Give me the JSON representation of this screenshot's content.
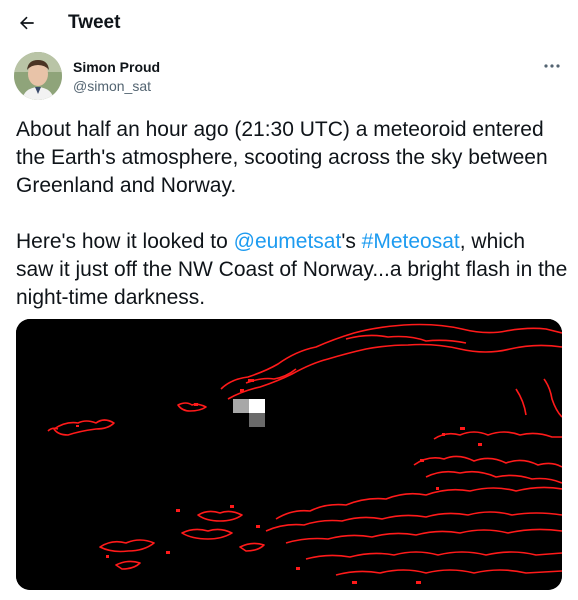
{
  "header": {
    "back_icon": "arrow-left-icon",
    "title": "Tweet"
  },
  "author": {
    "name": "Simon Proud",
    "handle": "@simon_sat",
    "avatar_icon": "user-avatar",
    "more_icon": "ellipsis-icon"
  },
  "tweet": {
    "para1": "About half an hour ago (21:30 UTC) a meteoroid entered the Earth's atmosphere, scooting across the sky between Greenland and Norway.",
    "para2_prefix": "Here's how it looked to ",
    "mention": "@eumetsat",
    "para2_mid": "'s ",
    "hashtag": "#Meteosat",
    "para2_suffix": ", which saw it just off the NW Coast of Norway...a bright flash in the night-time darkness."
  },
  "media": {
    "description_icon": "satellite-image",
    "coastline_color": "#ff1a1a",
    "background_color": "#000000"
  },
  "colors": {
    "link": "#1d9bf0",
    "text": "#0f1419",
    "secondary": "#536471"
  }
}
